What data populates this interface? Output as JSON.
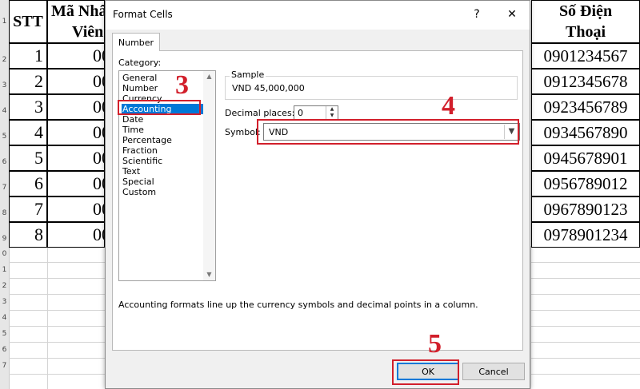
{
  "sheet": {
    "row_numbers": [
      "1",
      "2",
      "3",
      "4",
      "5",
      "6",
      "7",
      "8",
      "9",
      "0",
      "1",
      "2",
      "3",
      "4",
      "5",
      "6",
      "7"
    ],
    "headers": {
      "stt": "STT",
      "ma_line1": "Mã Nhâ",
      "ma_line2": "Viên",
      "sdt_line1": "Số Điện",
      "sdt_line2": "Thoại"
    },
    "rows": [
      {
        "stt": "1",
        "ma": "00",
        "sdt": "0901234567"
      },
      {
        "stt": "2",
        "ma": "00",
        "sdt": "0912345678"
      },
      {
        "stt": "3",
        "ma": "00",
        "sdt": "0923456789"
      },
      {
        "stt": "4",
        "ma": "00",
        "sdt": "0934567890"
      },
      {
        "stt": "5",
        "ma": "00",
        "sdt": "0945678901"
      },
      {
        "stt": "6",
        "ma": "00",
        "sdt": "0956789012"
      },
      {
        "stt": "7",
        "ma": "00",
        "sdt": "0967890123"
      },
      {
        "stt": "8",
        "ma": "00",
        "sdt": "0978901234"
      }
    ]
  },
  "dialog": {
    "title": "Format Cells",
    "help_label": "?",
    "close_label": "✕",
    "tab_label": "Number",
    "category_label": "Category:",
    "categories": [
      "General",
      "Number",
      "Currency",
      "Accounting",
      "Date",
      "Time",
      "Percentage",
      "Fraction",
      "Scientific",
      "Text",
      "Special",
      "Custom"
    ],
    "selected_category": "Accounting",
    "sample_label": "Sample",
    "sample_value": "VND 45,000,000",
    "decimal_label": "Decimal places:",
    "decimal_value": "0",
    "symbol_label": "Symbol:",
    "symbol_value": "VND",
    "description": "Accounting formats line up the currency symbols and decimal points in a column.",
    "ok_label": "OK",
    "cancel_label": "Cancel"
  },
  "annotations": {
    "step3": "3",
    "step4": "4",
    "step5": "5",
    "color": "#d21f2b"
  }
}
